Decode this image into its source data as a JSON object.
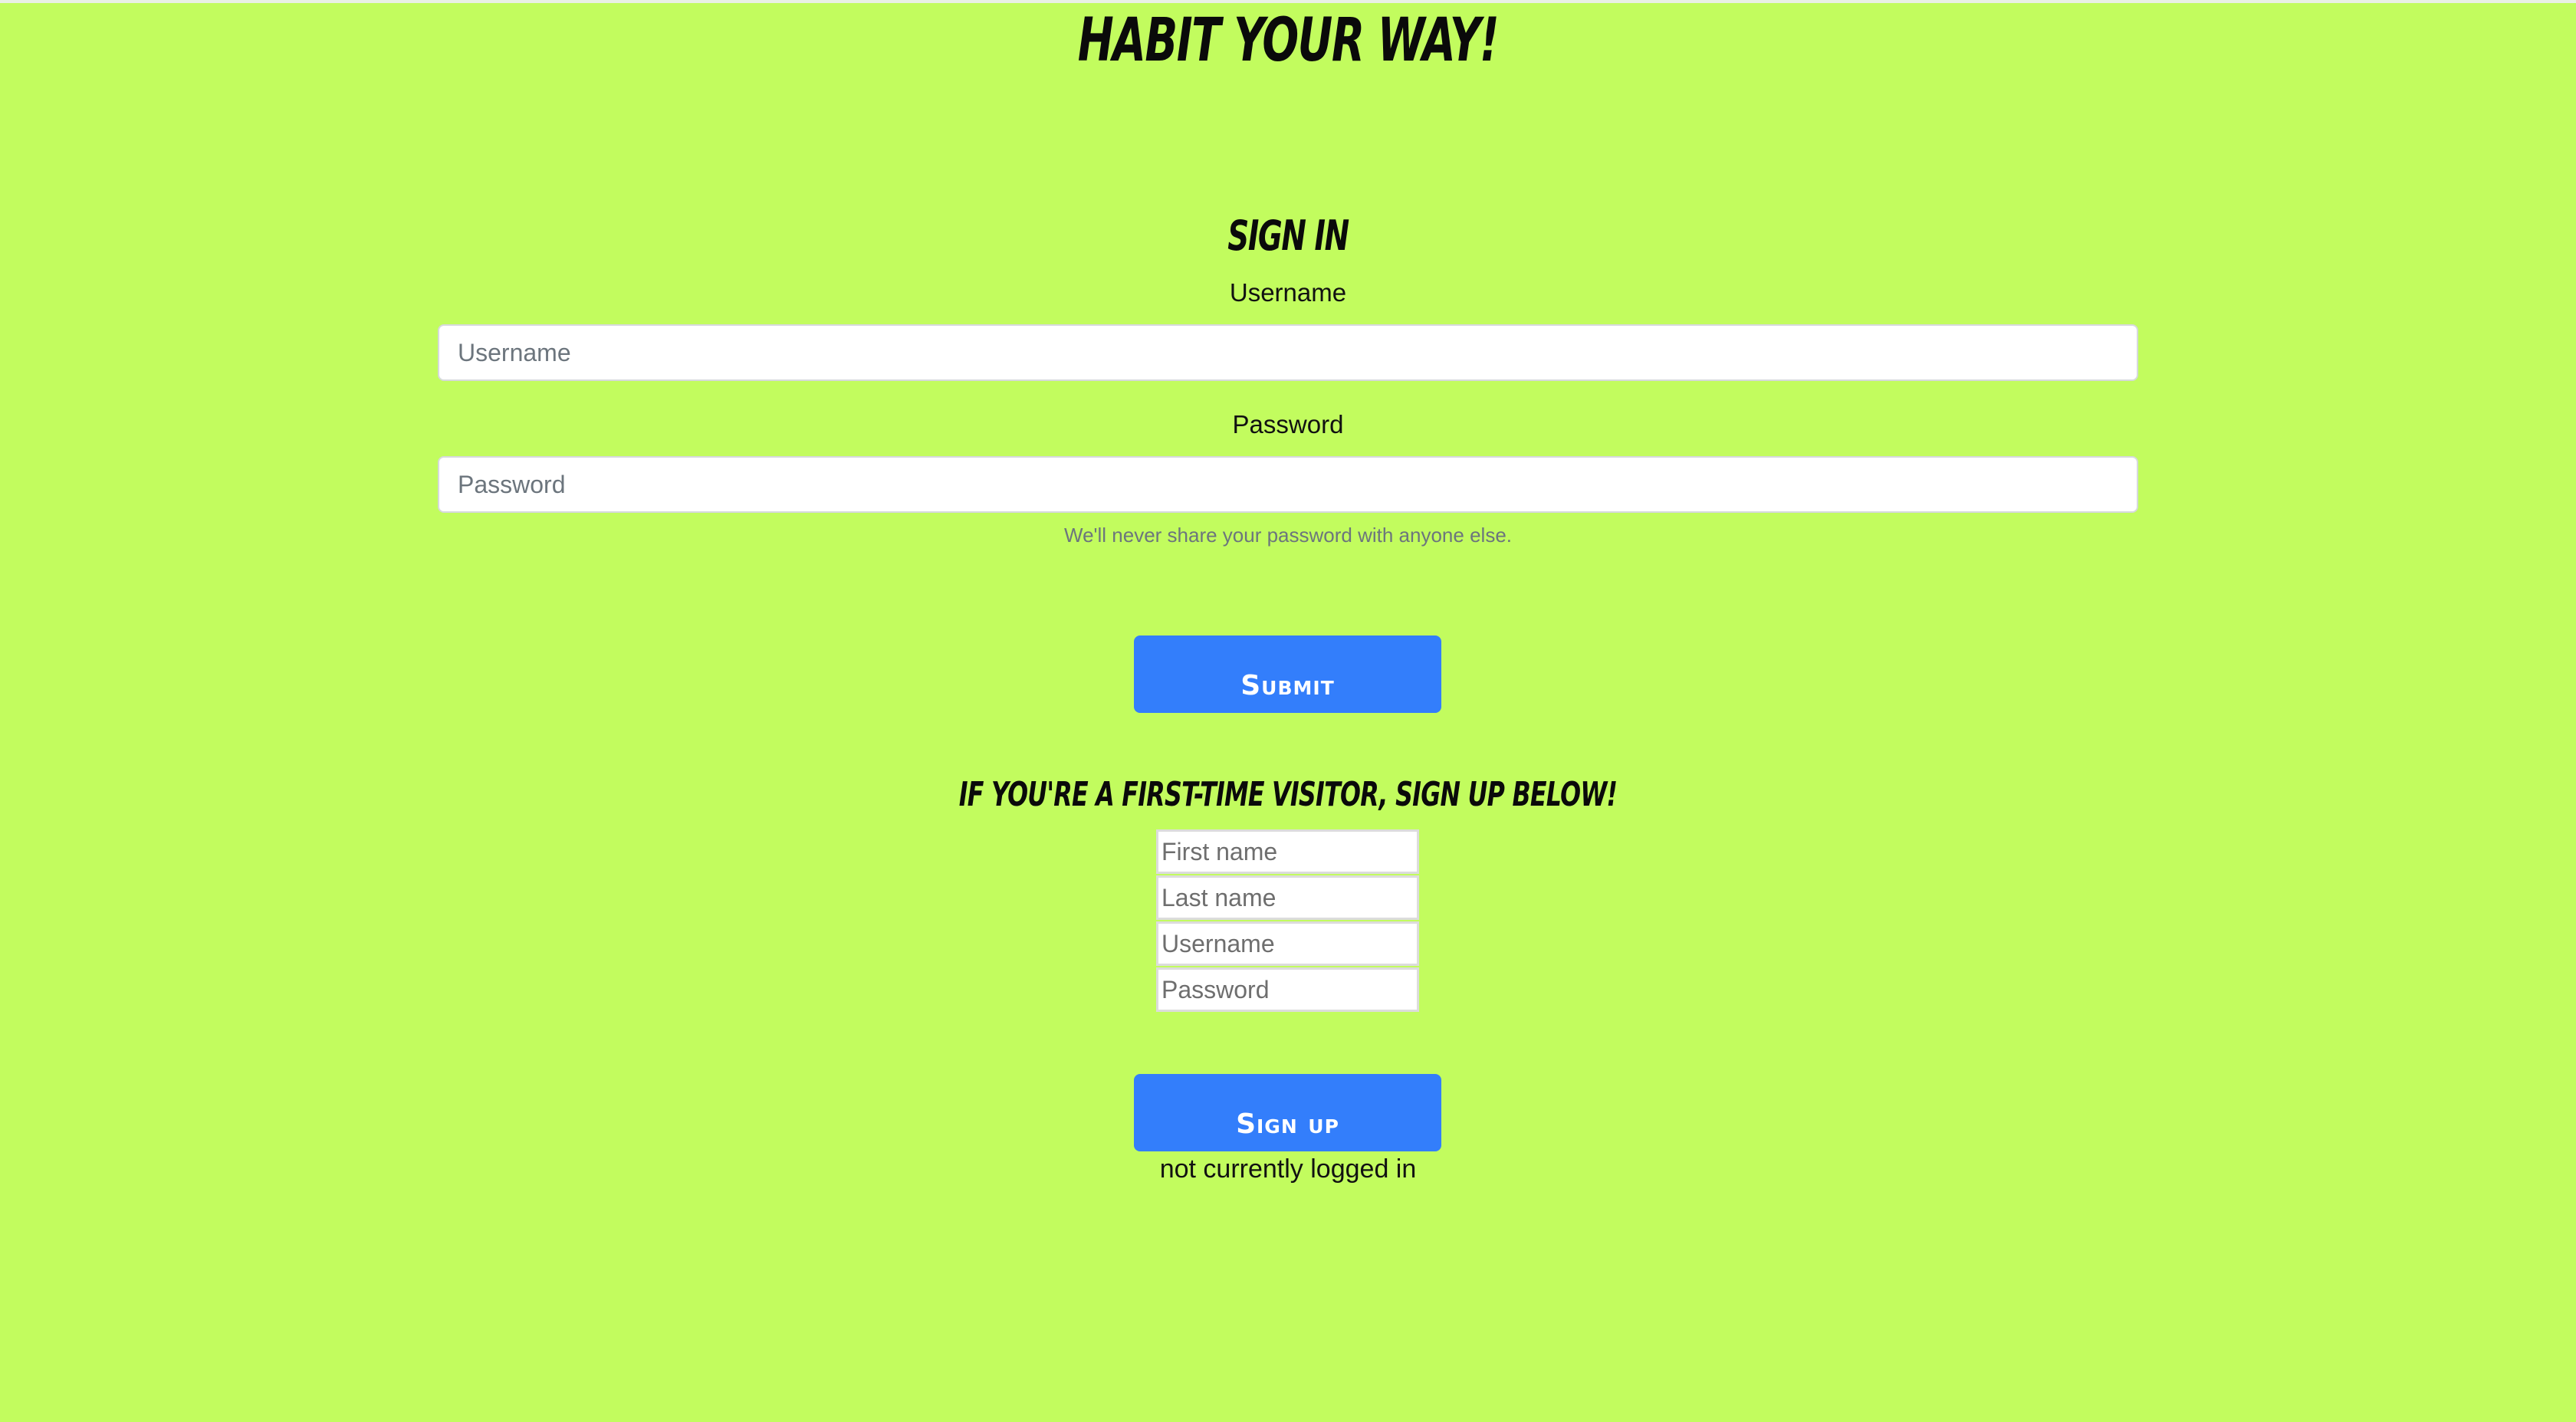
{
  "app": {
    "title": "HABIT YOUR WAY!"
  },
  "signin": {
    "heading": "SIGN IN",
    "username_label": "Username",
    "username_placeholder": "Username",
    "password_label": "Password",
    "password_placeholder": "Password",
    "help_text": "We'll never share your password with anyone else.",
    "submit_label": "Submit"
  },
  "signup": {
    "heading": "IF YOU'RE A FIRST-TIME VISITOR, SIGN UP BELOW!",
    "first_name_placeholder": "First name",
    "last_name_placeholder": "Last name",
    "username_placeholder": "Username",
    "password_placeholder": "Password",
    "button_label": "Sign up"
  },
  "status": {
    "text": "not currently logged in"
  },
  "colors": {
    "background": "#c2fc5e",
    "button": "#337efb",
    "button_text": "#ffffff",
    "help_text": "#6c757d"
  }
}
